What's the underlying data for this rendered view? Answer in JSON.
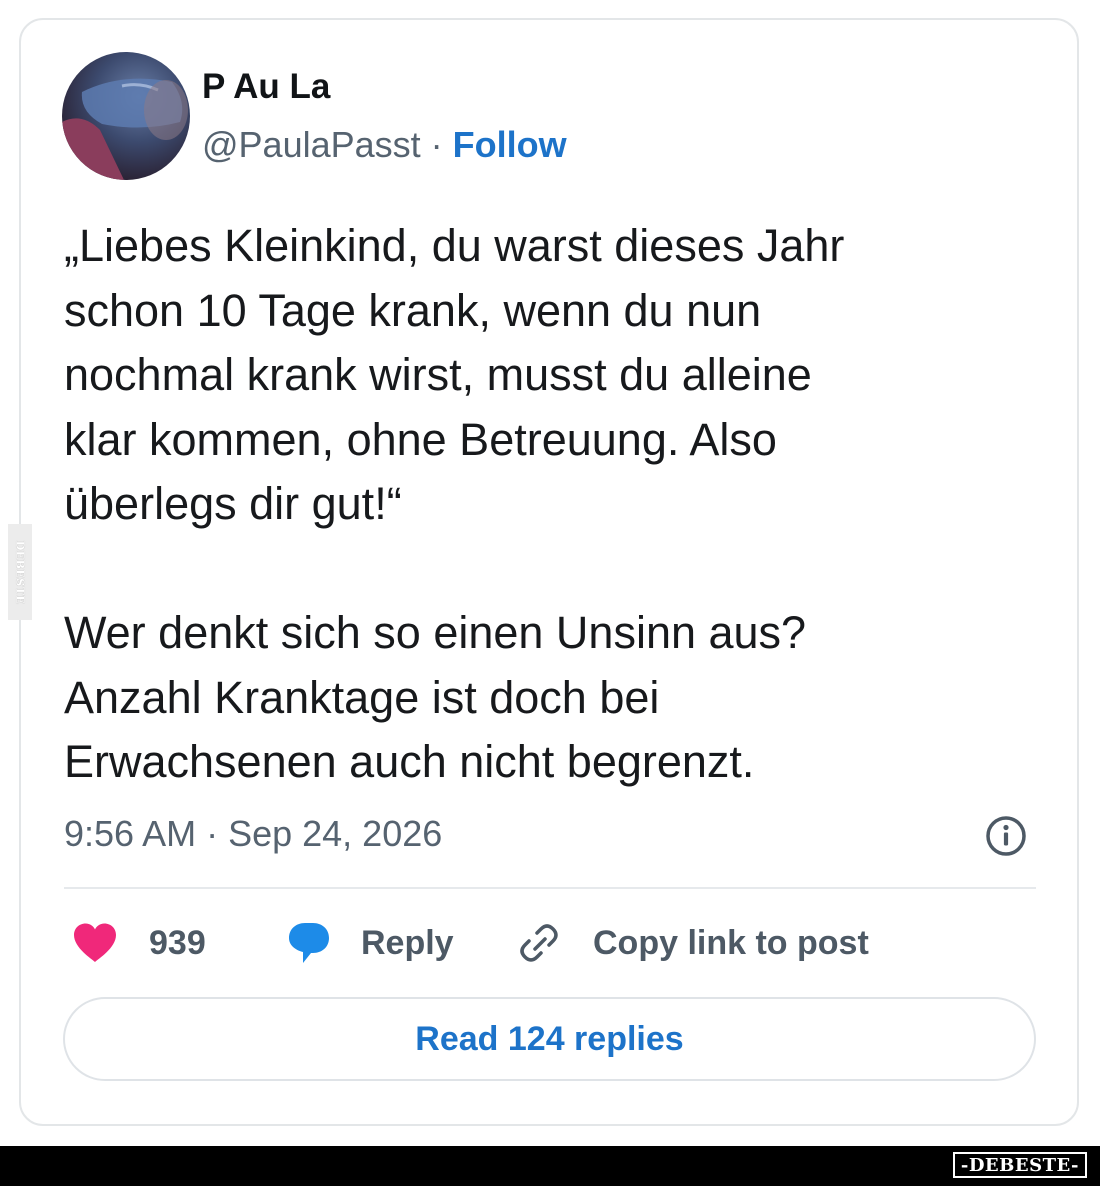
{
  "user": {
    "display_name": "P Au La",
    "handle": "@PaulaPasst",
    "separator": " · ",
    "follow_label": "Follow"
  },
  "post": {
    "text": "„Liebes Kleinkind, du warst dieses Jahr\nschon 10 Tage krank, wenn du nun\nnochmal krank wirst, musst du alleine\nklar kommen, ohne Betreuung. Also\nüberlegs dir gut!“\n\nWer denkt sich so einen Unsinn aus?\nAnzahl Kranktage ist doch bei\nErwachsenen auch nicht begrenzt.",
    "timestamp": "9:56 AM · Sep 24, 2026"
  },
  "actions": {
    "like_count": "939",
    "reply_label": "Reply",
    "copy_link_label": "Copy link to post"
  },
  "read_replies_label": "Read 124 replies",
  "watermark": {
    "side_text": "DEBESTE",
    "bottom_text": "-DEBESTE-"
  },
  "icons": {
    "heart": "heart-icon",
    "reply": "speech-bubble-icon",
    "link": "link-icon",
    "info": "info-icon"
  },
  "colors": {
    "accent": "#1d73c9",
    "like": "#f0287a",
    "text": "#17191c",
    "muted": "#566370"
  }
}
